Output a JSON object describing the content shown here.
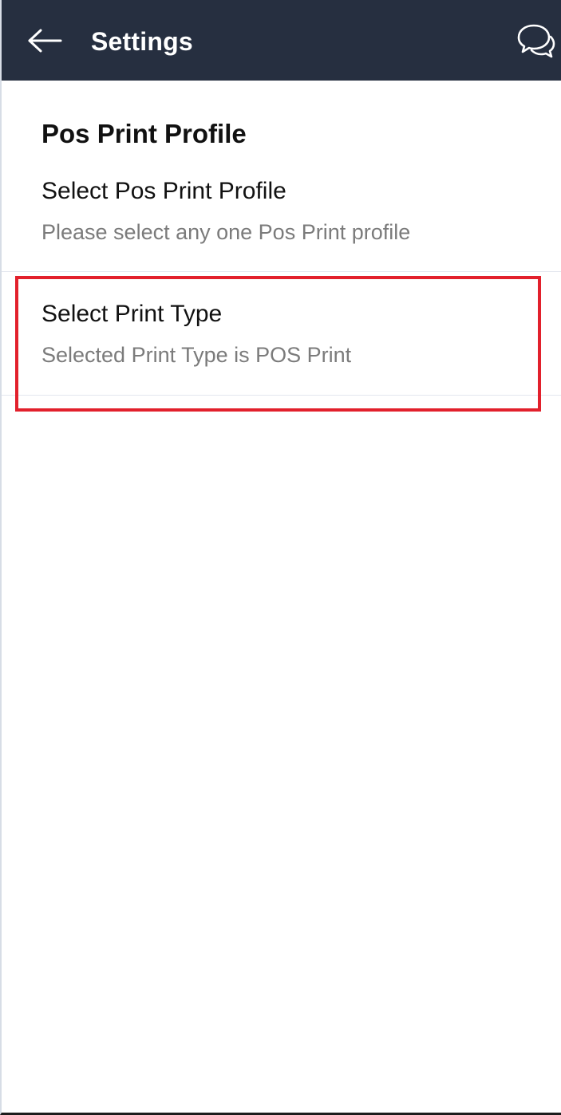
{
  "appbar": {
    "title": "Settings",
    "back_icon": "arrow-left-icon",
    "chat_icon": "chat-bubbles-icon",
    "background_color": "#262f40"
  },
  "section": {
    "header": "Pos Print Profile"
  },
  "preferences": [
    {
      "title": "Select Pos Print Profile",
      "summary": "Please select any one Pos Print profile"
    },
    {
      "title": "Select Print Type",
      "summary": "Selected Print Type is POS Print"
    }
  ],
  "highlight": {
    "color": "#e2202c",
    "target": "Select Print Type"
  }
}
